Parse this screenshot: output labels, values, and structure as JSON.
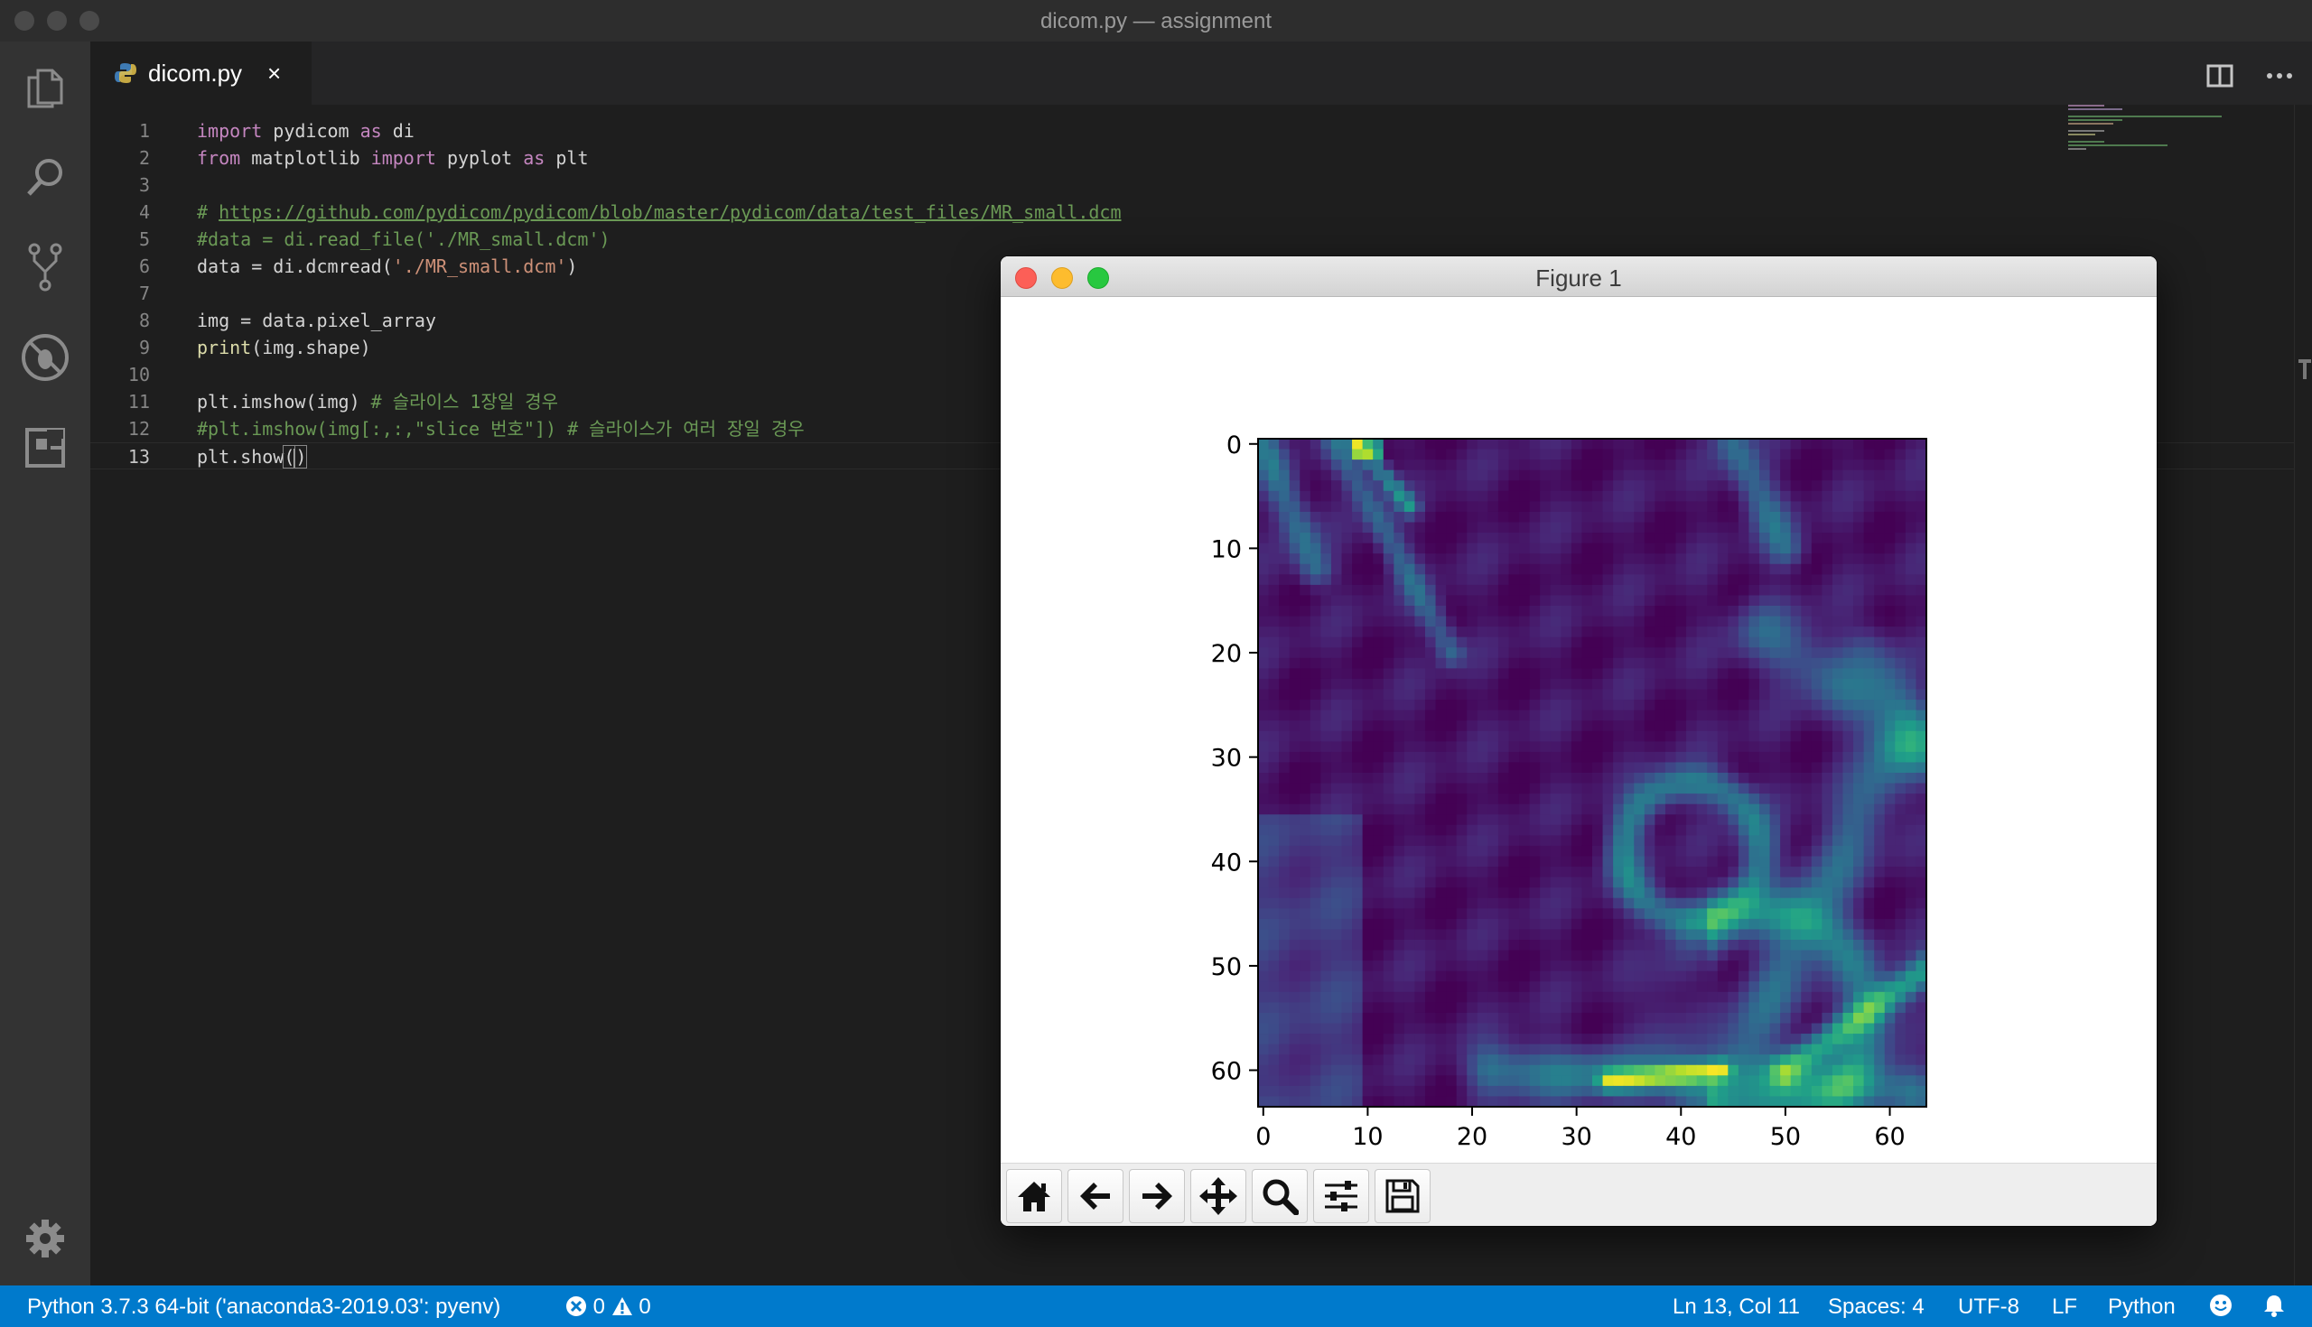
{
  "window": {
    "title": "dicom.py — assignment"
  },
  "tab": {
    "filename": "dicom.py",
    "close": "×"
  },
  "editor": {
    "current_line": 13,
    "lines": [
      {
        "num": "1",
        "tokens": [
          {
            "t": "import",
            "c": "kw"
          },
          {
            "t": " pydicom ",
            "c": ""
          },
          {
            "t": "as",
            "c": "kw"
          },
          {
            "t": " di",
            "c": ""
          }
        ]
      },
      {
        "num": "2",
        "tokens": [
          {
            "t": "from",
            "c": "kw"
          },
          {
            "t": " matplotlib ",
            "c": ""
          },
          {
            "t": "import",
            "c": "kw"
          },
          {
            "t": " pyplot ",
            "c": ""
          },
          {
            "t": "as",
            "c": "kw"
          },
          {
            "t": " plt",
            "c": ""
          }
        ]
      },
      {
        "num": "3",
        "tokens": []
      },
      {
        "num": "4",
        "tokens": [
          {
            "t": "# ",
            "c": "cmt"
          },
          {
            "t": "https://github.com/pydicom/pydicom/blob/master/pydicom/data/test_files/MR_small.dcm",
            "c": "link"
          }
        ]
      },
      {
        "num": "5",
        "tokens": [
          {
            "t": "#data = di.read_file('./MR_small.dcm')",
            "c": "cmt"
          }
        ]
      },
      {
        "num": "6",
        "tokens": [
          {
            "t": "data = di.dcmread(",
            "c": ""
          },
          {
            "t": "'./MR_small.dcm'",
            "c": "str"
          },
          {
            "t": ")",
            "c": ""
          }
        ]
      },
      {
        "num": "7",
        "tokens": []
      },
      {
        "num": "8",
        "tokens": [
          {
            "t": "img = data.pixel_array",
            "c": ""
          }
        ]
      },
      {
        "num": "9",
        "tokens": [
          {
            "t": "print",
            "c": "fn"
          },
          {
            "t": "(img.shape)",
            "c": ""
          }
        ]
      },
      {
        "num": "10",
        "tokens": []
      },
      {
        "num": "11",
        "tokens": [
          {
            "t": "plt.imshow(img) ",
            "c": ""
          },
          {
            "t": "# 슬라이스 1장일 경우",
            "c": "cmt"
          }
        ]
      },
      {
        "num": "12",
        "tokens": [
          {
            "t": "#plt.imshow(img[:,:,\"slice 번호\"]) # 슬라이스가 여러 장일 경우",
            "c": "cmt"
          }
        ]
      },
      {
        "num": "13",
        "tokens": [
          {
            "t": "plt.show",
            "c": ""
          },
          {
            "t": "()",
            "c": "bracket"
          }
        ]
      }
    ]
  },
  "figure": {
    "title": "Figure 1",
    "toolbar": [
      "home-icon",
      "back-arrow-icon",
      "forward-arrow-icon",
      "pan-icon",
      "zoom-icon",
      "configure-subplots-icon",
      "save-icon"
    ]
  },
  "chart_data": {
    "type": "heatmap",
    "title": "",
    "xlabel": "",
    "ylabel": "",
    "colormap": "viridis",
    "x_ticks": [
      "0",
      "10",
      "20",
      "30",
      "40",
      "50",
      "60"
    ],
    "y_ticks": [
      "0",
      "10",
      "20",
      "30",
      "40",
      "50",
      "60"
    ],
    "xlim": [
      -0.5,
      63.5
    ],
    "ylim": [
      63.5,
      -0.5
    ],
    "shape": [
      64,
      64
    ],
    "description_source": "MR_small.dcm pixel_array"
  },
  "status": {
    "interpreter": "Python 3.7.3 64-bit ('anaconda3-2019.03': pyenv)",
    "errors": "0",
    "warnings": "0",
    "position": "Ln 13, Col 11",
    "spaces": "Spaces: 4",
    "encoding": "UTF-8",
    "eol": "LF",
    "language": "Python"
  }
}
